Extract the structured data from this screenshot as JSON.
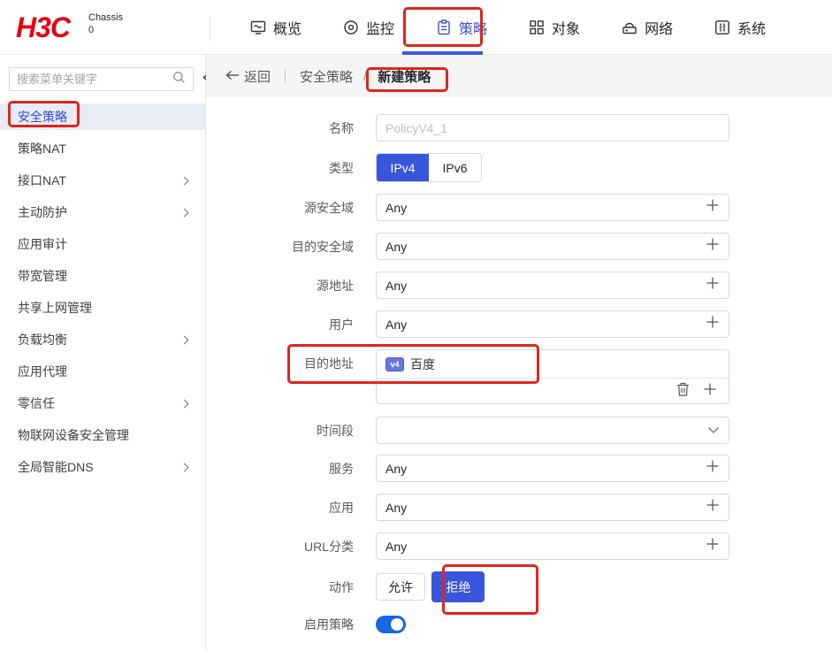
{
  "header": {
    "logo": "H3C",
    "device": {
      "line1": "Chassis",
      "line2": "0"
    },
    "nav": [
      {
        "label": "概览",
        "icon": "overview-icon",
        "active": false
      },
      {
        "label": "监控",
        "icon": "monitor-icon",
        "active": false
      },
      {
        "label": "策略",
        "icon": "policy-icon",
        "active": true
      },
      {
        "label": "对象",
        "icon": "objects-icon",
        "active": false
      },
      {
        "label": "网络",
        "icon": "network-icon",
        "active": false
      },
      {
        "label": "系统",
        "icon": "system-icon",
        "active": false
      }
    ]
  },
  "sidebar": {
    "search_placeholder": "搜索菜单关键字",
    "items": [
      {
        "label": "安全策略",
        "selected": true,
        "expandable": false
      },
      {
        "label": "策略NAT",
        "selected": false,
        "expandable": false
      },
      {
        "label": "接口NAT",
        "selected": false,
        "expandable": true
      },
      {
        "label": "主动防护",
        "selected": false,
        "expandable": true
      },
      {
        "label": "应用审计",
        "selected": false,
        "expandable": false
      },
      {
        "label": "带宽管理",
        "selected": false,
        "expandable": false
      },
      {
        "label": "共享上网管理",
        "selected": false,
        "expandable": false
      },
      {
        "label": "负载均衡",
        "selected": false,
        "expandable": true
      },
      {
        "label": "应用代理",
        "selected": false,
        "expandable": false
      },
      {
        "label": "零信任",
        "selected": false,
        "expandable": true
      },
      {
        "label": "物联网设备安全管理",
        "selected": false,
        "expandable": false
      },
      {
        "label": "全局智能DNS",
        "selected": false,
        "expandable": true
      }
    ]
  },
  "breadcrumb": {
    "back": "返回",
    "parent": "安全策略",
    "separator": "/",
    "current": "新建策略"
  },
  "form": {
    "name": {
      "label": "名称",
      "value": "",
      "placeholder": "PolicyV4_1"
    },
    "type": {
      "label": "类型",
      "options": {
        "ipv4": "IPv4",
        "ipv6": "IPv6"
      },
      "selected": "IPv4"
    },
    "src_zone": {
      "label": "源安全域",
      "value": "Any"
    },
    "dst_zone": {
      "label": "目的安全域",
      "value": "Any"
    },
    "src_addr": {
      "label": "源地址",
      "value": "Any"
    },
    "user": {
      "label": "用户",
      "value": "Any"
    },
    "dst_addr": {
      "label": "目的地址",
      "tag": "百度",
      "tag_icon_label": "v4"
    },
    "time_range": {
      "label": "时间段",
      "value": ""
    },
    "service": {
      "label": "服务",
      "value": "Any"
    },
    "application": {
      "label": "应用",
      "value": "Any"
    },
    "url_category": {
      "label": "URL分类",
      "value": "Any"
    },
    "action": {
      "label": "动作",
      "options": {
        "allow": "允许",
        "deny": "拒绝"
      },
      "selected": "拒绝"
    },
    "enable_policy": {
      "label": "启用策略",
      "on": true
    }
  },
  "icons": [
    "overview-icon",
    "monitor-icon",
    "policy-icon",
    "objects-icon",
    "network-icon",
    "system-icon",
    "search-icon",
    "collapse-sidebar-icon",
    "chevron-right-icon",
    "back-arrow-icon",
    "ipv4-object-icon",
    "trash-icon",
    "plus-icon",
    "chevron-down-icon",
    "toggle-switch"
  ],
  "colors": {
    "brand_red": "#e60012",
    "annotation_red": "#e1251b",
    "accent_blue": "#3955dc",
    "active_nav_blue": "#3d4fd0",
    "tab_underline_blue": "#3a5bdd",
    "sidebar_selected_bg": "#e9ecf7",
    "sidebar_selected_text": "#2e4bd4",
    "toggle_blue": "#1766e6",
    "crumbbar_bg": "#f5f5f5",
    "input_border": "#d9d9d9"
  }
}
